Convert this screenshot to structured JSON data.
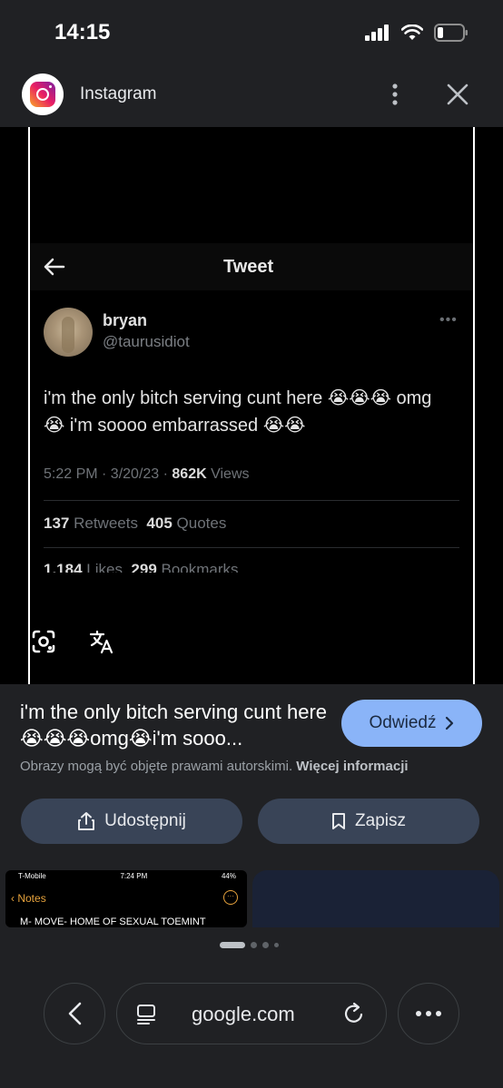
{
  "status_bar": {
    "time": "14:15"
  },
  "source": {
    "name": "Instagram",
    "logo_icon": "instagram-logo"
  },
  "tweet": {
    "page_title": "Tweet",
    "name": "bryan",
    "handle": "@taurusidiot",
    "text": "i'm the only bitch serving cunt here 😭😭😭 omg 😭 i'm soooo embarrassed 😭😭",
    "time": "5:22 PM · 3/20/23 · ",
    "views_count": "862K",
    "views_label": " Views",
    "retweets_count": "137",
    "retweets_label": " Retweets  ",
    "quotes_count": "405",
    "quotes_label": " Quotes",
    "likes_count": "1,184",
    "likes_label": " Likes  ",
    "bookmarks_count": "299",
    "bookmarks_label": " Bookmarks"
  },
  "result": {
    "title": "i'm the only bitch serving cunt here😭😭😭omg😭i'm sooo...",
    "visit_label": "Odwiedź",
    "copyright_text": "Obrazy mogą być objęte prawami autorskimi. ",
    "more_info_label": "Więcej informacji",
    "share_label": "Udostępnij",
    "save_label": "Zapisz"
  },
  "thumbnail": {
    "carrier": "T-Mobile",
    "time": "7:24 PM",
    "battery": "44%",
    "notes_label": "Notes",
    "text": "M- MOVE- HOME OF SEXUAL TOEMINT"
  },
  "browser": {
    "url": "google.com"
  },
  "colors": {
    "background": "#202124",
    "accent_button": "#8ab4f8",
    "action_button": "#394457"
  }
}
